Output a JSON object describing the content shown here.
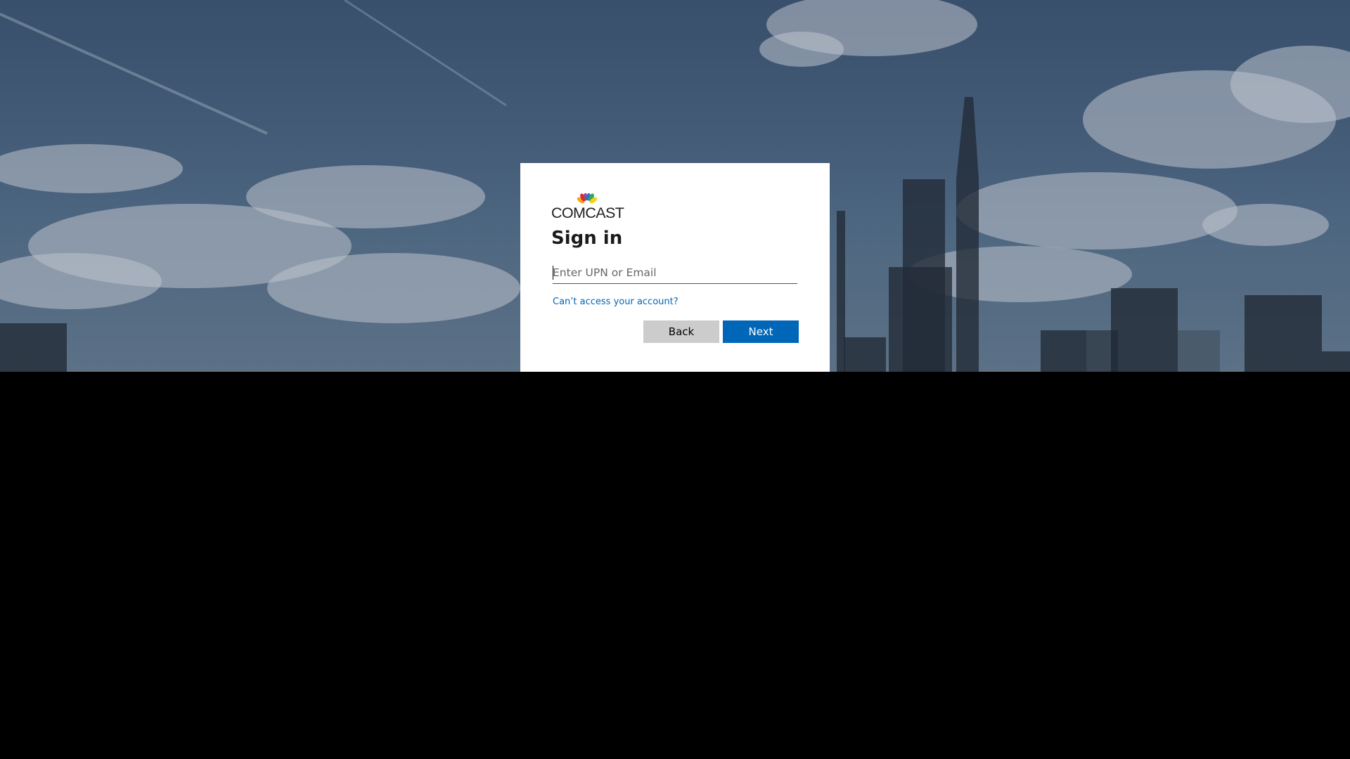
{
  "brand": {
    "name": "COMCAST"
  },
  "signin": {
    "title": "Sign in",
    "input_placeholder": "Enter UPN or Email",
    "input_value": "",
    "help_link": "Can’t access your account?",
    "back_label": "Back",
    "next_label": "Next"
  },
  "colors": {
    "accent": "#0067b8",
    "back_button": "#cccccc",
    "card": "#ffffff",
    "lower_area": "#000000"
  },
  "icons": {
    "logo": "nbc-peacock-icon"
  }
}
